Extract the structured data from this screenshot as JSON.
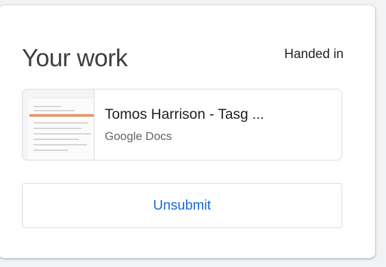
{
  "work_card": {
    "title": "Your work",
    "status": "Handed in",
    "attachment": {
      "name": "Tomos Harrison - Tasg ...",
      "type": "Google Docs",
      "thumbnail_icon": "document-thumbnail"
    },
    "unsubmit_label": "Unsubmit"
  },
  "colors": {
    "accent": "#1967d2",
    "border": "#dadce0",
    "title_text": "#3c4043",
    "secondary_text": "#5f6368"
  }
}
